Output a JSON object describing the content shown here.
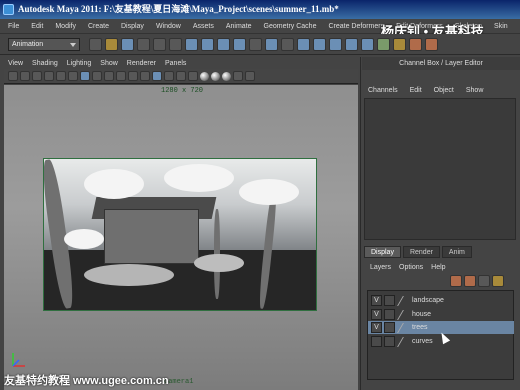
{
  "window": {
    "title": "Autodesk Maya 2011: F:\\友基教程\\夏日海滩\\Maya_Project\\scenes\\summer_11.mb*"
  },
  "menubar": [
    "File",
    "Edit",
    "Modify",
    "Create",
    "Display",
    "Window",
    "Assets",
    "Animate",
    "Geometry Cache",
    "Create Deformers",
    "Edit Deformers",
    "Skeleton",
    "Skin"
  ],
  "shelf": {
    "mode": "Animation"
  },
  "viewport": {
    "menu": [
      "View",
      "Shading",
      "Lighting",
      "Show",
      "Renderer",
      "Panels"
    ],
    "resolution": "1280 x 720",
    "camera": "camera1"
  },
  "channel_box": {
    "title": "Channel Box / Layer Editor",
    "menu": [
      "Channels",
      "Edit",
      "Object",
      "Show"
    ]
  },
  "layer_editor": {
    "tabs": [
      "Display",
      "Render",
      "Anim"
    ],
    "active_tab": "Display",
    "menu": [
      "Layers",
      "Options",
      "Help"
    ],
    "layers": [
      {
        "visible": "V",
        "name": "landscape",
        "selected": false
      },
      {
        "visible": "V",
        "name": "house",
        "selected": false
      },
      {
        "visible": "V",
        "name": "trees",
        "selected": true
      },
      {
        "visible": "",
        "name": "curves",
        "selected": false
      }
    ]
  },
  "watermarks": {
    "top": "杨庆钊 • 友基科技",
    "bottom": "友基特约教程 www.ugee.com.cn"
  },
  "colors": {
    "selection": "#6a85a3",
    "title_bar": "#0a246a",
    "resolution_gate": "#2f6f3f"
  }
}
